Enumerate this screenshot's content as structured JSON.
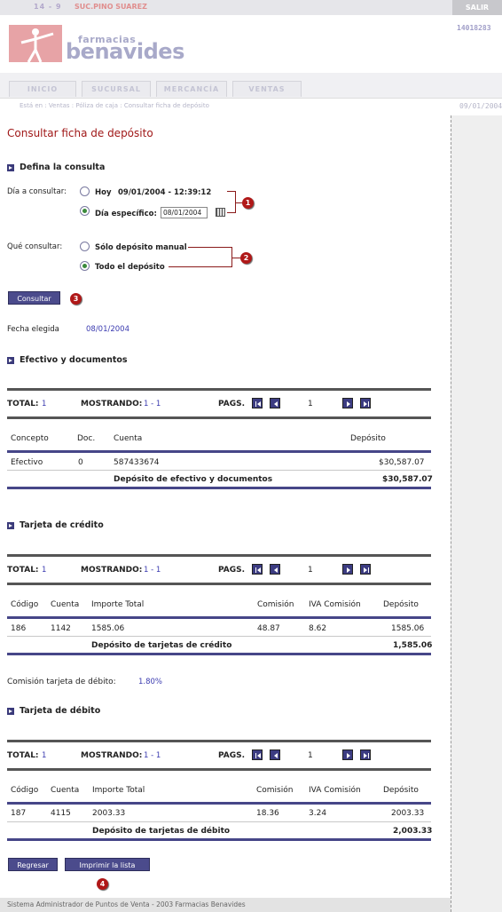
{
  "topbar": {
    "store_num": "14 - 9",
    "store_name": "SUC.PINO SUAREZ",
    "logout": "SALIR"
  },
  "user_code": "14018283",
  "logo": {
    "line1": "farmacias",
    "line2": "benavides",
    "colors": {
      "pink": "#e7a3a6",
      "lavender": "#a8a9c9"
    }
  },
  "tabs": [
    "INICIO",
    "SUCURSAL",
    "MERCANCÍA",
    "VENTAS"
  ],
  "breadcrumb": "Está en : Ventas : Póliza de caja : Consultar ficha de depósito",
  "header_date": "09/01/2004",
  "page_title": "Consultar ficha de depósito",
  "query": {
    "section": "Defina la consulta",
    "day_label": "Día a consultar:",
    "today_label": "Hoy",
    "today_value": "09/01/2004 - 12:39:12",
    "specific_label": "Día específico:",
    "specific_value": "08/01/2004",
    "what_label": "Qué consultar:",
    "opt_manual": "Sólo depósito manual",
    "opt_all": "Todo el depósito",
    "consult_button": "Consultar",
    "selected_day": "specific",
    "selected_what": "all"
  },
  "badges": [
    "1",
    "2",
    "3",
    "4"
  ],
  "chosen": {
    "label": "Fecha elegida",
    "value": "08/01/2004"
  },
  "cash": {
    "section": "Efectivo y documentos",
    "pager": {
      "total_label": "TOTAL:",
      "total": "1",
      "showing_label": "MOSTRANDO:",
      "showing": "1 - 1",
      "pages_label": "PAGS.",
      "page": "1"
    },
    "headers": [
      "Concepto",
      "Doc.",
      "Cuenta",
      "Depósito"
    ],
    "rows": [
      [
        "Efectivo",
        "0",
        "587433674",
        "$30,587.07"
      ]
    ],
    "total_label": "Depósito de efectivo y documentos",
    "total_value": "$30,587.07"
  },
  "credit": {
    "section": "Tarjeta de crédito",
    "pager": {
      "total_label": "TOTAL:",
      "total": "1",
      "showing_label": "MOSTRANDO:",
      "showing": "1 - 1",
      "pages_label": "PAGS.",
      "page": "1"
    },
    "headers": [
      "Código",
      "Cuenta",
      "Importe Total",
      "Comisión",
      "IVA Comisión",
      "Depósito"
    ],
    "rows": [
      [
        "186",
        "1142",
        "1585.06",
        "48.87",
        "8.62",
        "1585.06"
      ]
    ],
    "total_label": "Depósito de tarjetas de crédito",
    "total_value": "1,585.06"
  },
  "debit_commission": {
    "label": "Comisión tarjeta de débito:",
    "value": "1.80%"
  },
  "debit": {
    "section": "Tarjeta de débito",
    "pager": {
      "total_label": "TOTAL:",
      "total": "1",
      "showing_label": "MOSTRANDO:",
      "showing": "1 - 1",
      "pages_label": "PAGS.",
      "page": "1"
    },
    "headers": [
      "Código",
      "Cuenta",
      "Importe Total",
      "Comisión",
      "IVA Comisión",
      "Depósito"
    ],
    "rows": [
      [
        "187",
        "4115",
        "2003.33",
        "18.36",
        "3.24",
        "2003.33"
      ]
    ],
    "total_label": "Depósito de tarjetas de débito",
    "total_value": "2,003.33"
  },
  "buttons": {
    "back": "Regresar",
    "print": "Imprimir la lista"
  },
  "footer": "Sistema Administrador de Puntos de Venta - 2003 Farmacias Benavides"
}
